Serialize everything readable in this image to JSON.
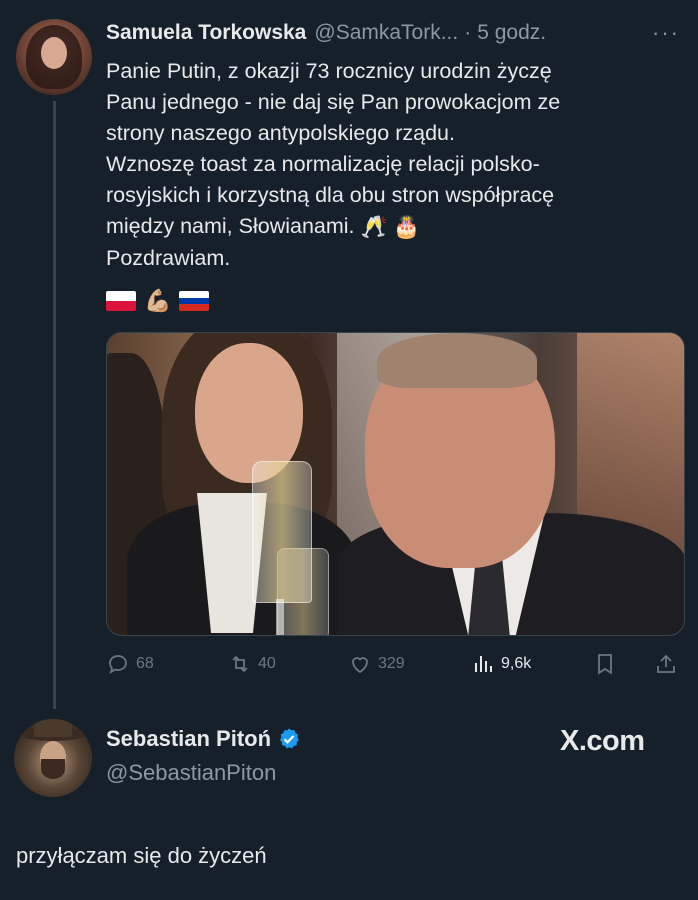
{
  "tweet": {
    "author_name": "Samuela Torkowska",
    "author_handle": "@SamkaTork...",
    "separator": "·",
    "time": "5 godz.",
    "more": "···",
    "text": "Panie Putin, z okazji 73 rocznicy urodzin życzę\nPanu jednego - nie daj się Pan prowokacjom ze\nstrony naszego antypolskiego rządu.\nWznoszę toast za normalizację relacji polsko-\nrosyjskich i korzystną dla obu stron współpracę\nmiędzy nami, Słowianami.",
    "text_emoji": "🥂 🎂",
    "text_last": "Pozdrawiam.",
    "emoji_line": [
      "polish-flag",
      "flexed-biceps",
      "russian-flag"
    ],
    "biceps": "💪🏼",
    "stats": {
      "replies": "68",
      "retweets": "40",
      "likes": "329",
      "views": "9,6k"
    }
  },
  "colors": {
    "background": "#15202b",
    "text": "#e7e9ea",
    "muted": "#8b98a5",
    "action": "#6e767d",
    "verified": "#1d9bf0"
  },
  "reply": {
    "author_name": "Sebastian Pitoń",
    "author_handle": "@SebastianPiton",
    "brand": "X.com",
    "text": "przyłączam się do życzeń"
  }
}
